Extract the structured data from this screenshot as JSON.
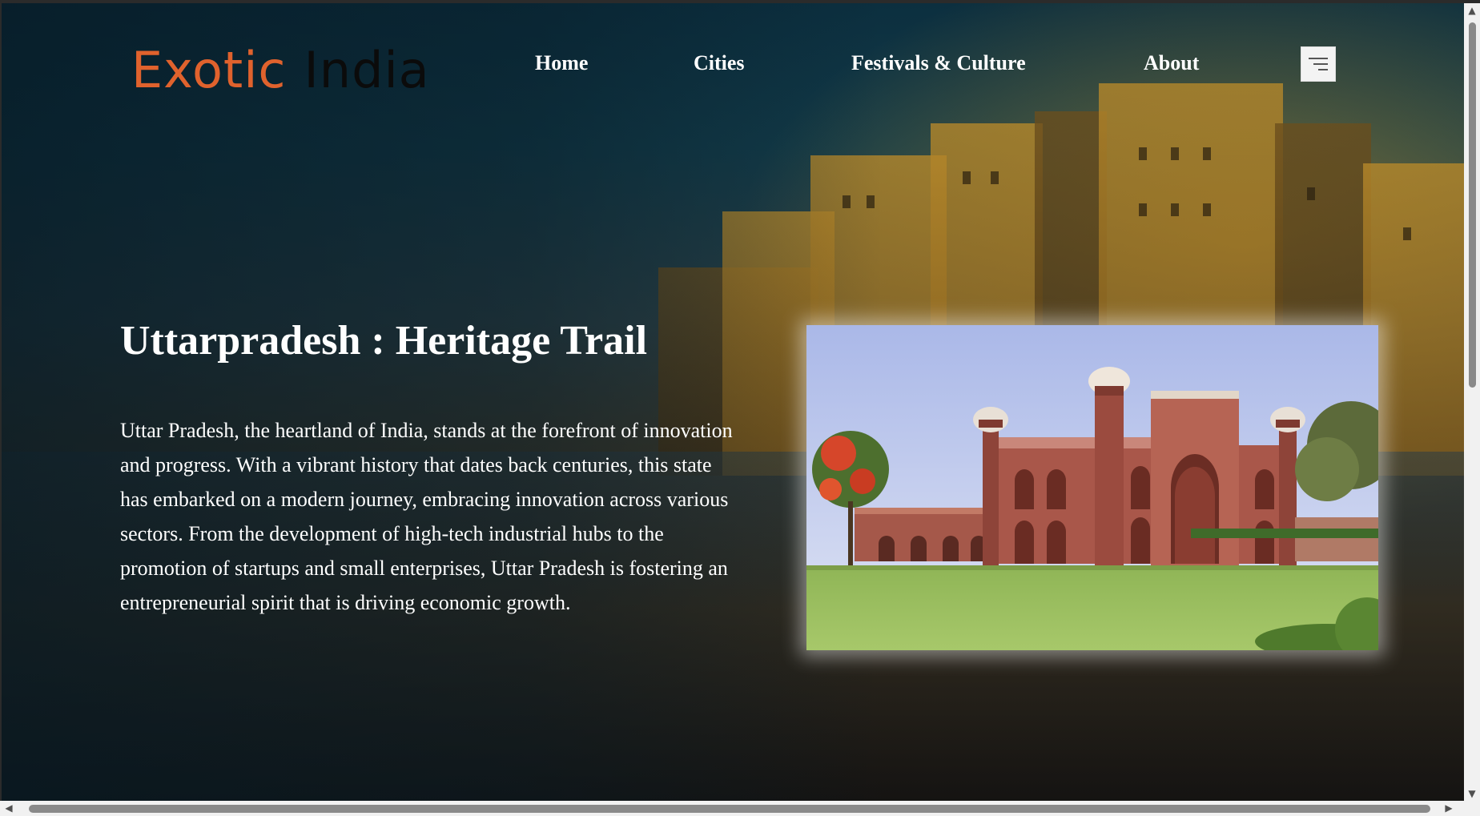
{
  "logo": {
    "word1": "Exotic",
    "word2": "India"
  },
  "nav": {
    "items": [
      {
        "label": "Home"
      },
      {
        "label": "Cities"
      },
      {
        "label": "Festivals & Culture"
      },
      {
        "label": "About"
      }
    ],
    "menu_icon": "hamburger-menu-icon"
  },
  "hero": {
    "title": "Uttarpradesh : Heritage Trail",
    "description": "Uttar Pradesh, the heartland of India, stands at the forefront of innovation and progress. With a vibrant history that dates back centuries, this state has embarked on a modern journey, embracing innovation across various sectors. From the development of high-tech industrial hubs to the promotion of startups and small enterprises, Uttar Pradesh is fostering an entrepreneurial spirit that is driving economic growth."
  },
  "scrollbars": {
    "up_icon": "▲",
    "down_icon": "▼",
    "left_icon": "◀",
    "right_icon": "▶"
  },
  "colors": {
    "logo_accent": "#e0622d",
    "logo_dark": "#0b0b0b",
    "text": "#ffffff"
  }
}
